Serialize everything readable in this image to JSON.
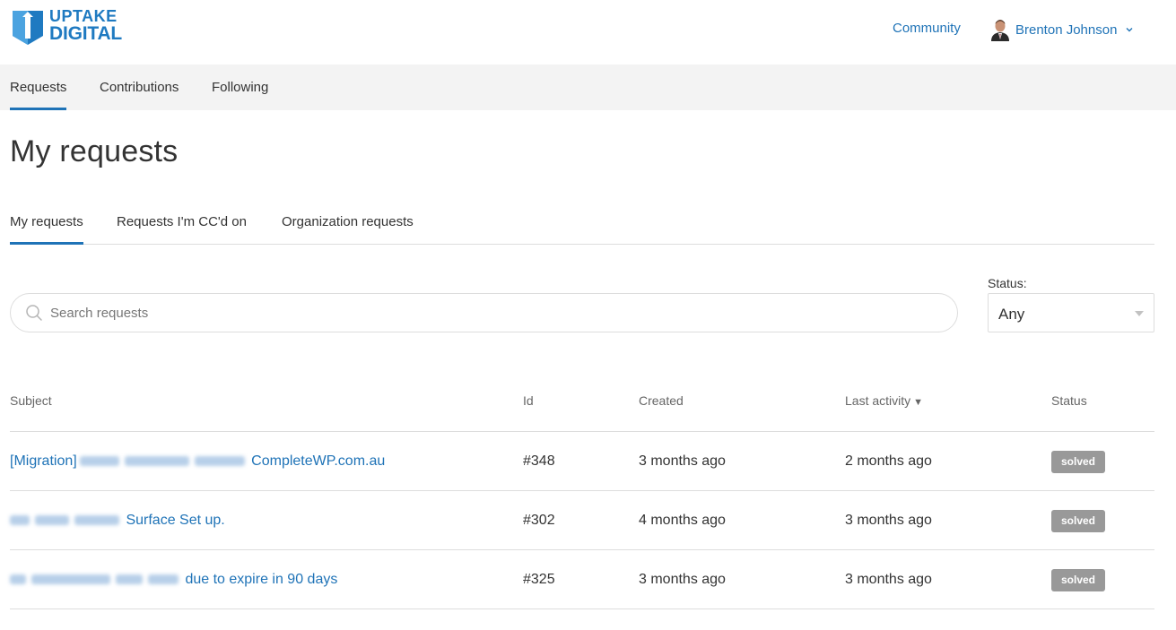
{
  "brand": {
    "line1": "UPTAKE",
    "line2": "DIGITAL",
    "color": "#1f7ac1"
  },
  "header": {
    "community_label": "Community",
    "user_name": "Brenton Johnson",
    "user_menu_icon": "chevron-down-icon"
  },
  "nav": {
    "items": [
      {
        "label": "Requests",
        "active": true
      },
      {
        "label": "Contributions",
        "active": false
      },
      {
        "label": "Following",
        "active": false
      }
    ]
  },
  "page": {
    "title": "My requests"
  },
  "subtabs": {
    "items": [
      {
        "label": "My requests",
        "active": true
      },
      {
        "label": "Requests I'm CC'd on",
        "active": false
      },
      {
        "label": "Organization requests",
        "active": false
      }
    ]
  },
  "search": {
    "placeholder": "Search requests",
    "value": "",
    "icon": "search-icon"
  },
  "status_filter": {
    "label": "Status:",
    "selected": "Any"
  },
  "table": {
    "columns": {
      "subject": "Subject",
      "id": "Id",
      "created": "Created",
      "last_activity": "Last activity",
      "status": "Status"
    },
    "sort_indicator": "▼",
    "rows": [
      {
        "subject_prefix": "[Migration]",
        "subject_suffix": "CompleteWP.com.au",
        "id": "#348",
        "created": "3 months ago",
        "last_activity": "2 months ago",
        "status": "solved"
      },
      {
        "subject_prefix": "",
        "subject_suffix": "Surface Set up.",
        "id": "#302",
        "created": "4 months ago",
        "last_activity": "3 months ago",
        "status": "solved"
      },
      {
        "subject_prefix": "",
        "subject_suffix": "due to expire in 90 days",
        "id": "#325",
        "created": "3 months ago",
        "last_activity": "3 months ago",
        "status": "solved"
      }
    ]
  },
  "colors": {
    "accent": "#1f73b7",
    "badge_solved": "#999999",
    "navbar_bg": "#f3f3f3"
  }
}
